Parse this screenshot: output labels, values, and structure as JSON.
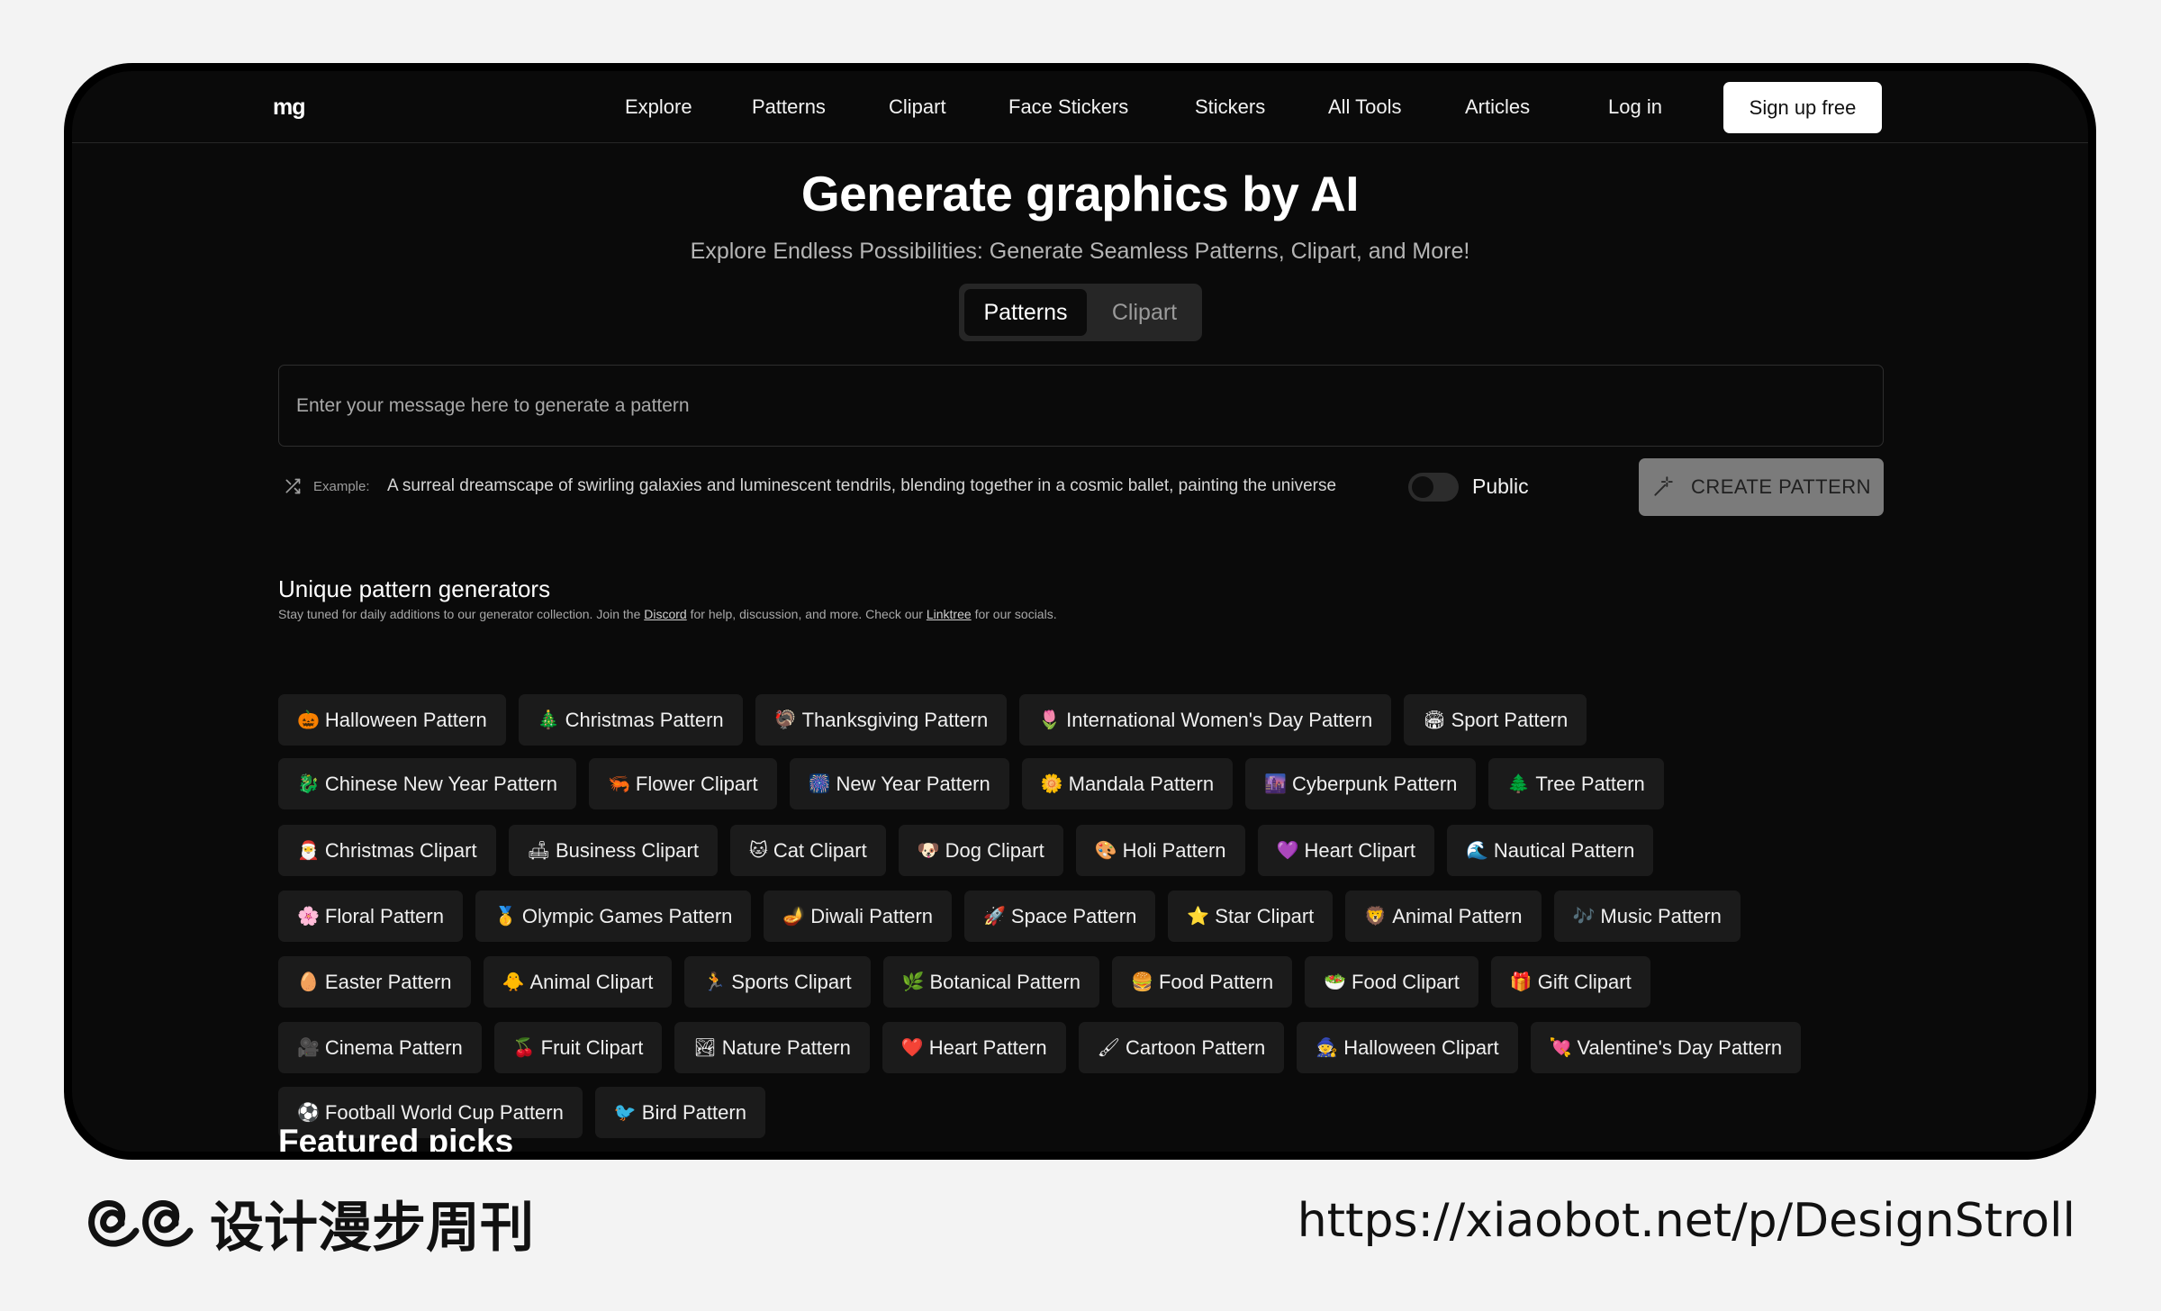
{
  "nav": {
    "logo": "mg",
    "links": [
      "Explore",
      "Patterns",
      "Clipart",
      "Face Stickers",
      "Stickers",
      "All Tools",
      "Articles"
    ],
    "login": "Log in",
    "signup": "Sign up free"
  },
  "hero": {
    "title": "Generate graphics by AI",
    "subtitle": "Explore Endless Possibilities: Generate Seamless Patterns, Clipart, and More!"
  },
  "segmented": {
    "active": "Patterns",
    "inactive": "Clipart"
  },
  "prompt": {
    "placeholder": "Enter your message here to generate a pattern"
  },
  "example": {
    "label": "Example:",
    "text": "A surreal dreamscape of swirling galaxies and luminescent tendrils, blending together in a cosmic ballet, painting the universe"
  },
  "visibility": {
    "label": "Public",
    "on": false
  },
  "create_button": "CREATE PATTERN",
  "generators": {
    "title": "Unique pattern generators",
    "sub_prefix": "Stay tuned for daily additions to our generator collection. Join the",
    "discord": "Discord",
    "sub_middle": "for help, discussion, and more. Check our",
    "linktree": "Linktree",
    "sub_suffix": "for our socials.",
    "rows": [
      [
        {
          "icon": "🎃",
          "label": "Halloween Pattern"
        },
        {
          "icon": "🎄",
          "label": "Christmas Pattern"
        },
        {
          "icon": "🦃",
          "label": "Thanksgiving Pattern"
        },
        {
          "icon": "🌷",
          "label": "International Women's Day Pattern"
        },
        {
          "icon": "🏟",
          "label": "Sport Pattern"
        }
      ],
      [
        {
          "icon": "🐉",
          "label": "Chinese New Year Pattern"
        },
        {
          "icon": "🦐",
          "label": "Flower Clipart"
        },
        {
          "icon": "🎆",
          "label": "New Year Pattern"
        },
        {
          "icon": "🌼",
          "label": "Mandala Pattern"
        },
        {
          "icon": "🌆",
          "label": "Cyberpunk Pattern"
        },
        {
          "icon": "🌲",
          "label": "Tree Pattern"
        }
      ],
      [
        {
          "icon": "🎅",
          "label": "Christmas Clipart"
        },
        {
          "icon": "🛋",
          "label": "Business Clipart"
        },
        {
          "icon": "🐱",
          "label": "Cat Clipart"
        },
        {
          "icon": "🐶",
          "label": "Dog Clipart"
        },
        {
          "icon": "🎨",
          "label": "Holi Pattern"
        },
        {
          "icon": "💜",
          "label": "Heart Clipart"
        },
        {
          "icon": "🌊",
          "label": "Nautical Pattern"
        }
      ],
      [
        {
          "icon": "🌸",
          "label": "Floral Pattern"
        },
        {
          "icon": "🥇",
          "label": "Olympic Games Pattern"
        },
        {
          "icon": "🪔",
          "label": "Diwali Pattern"
        },
        {
          "icon": "🚀",
          "label": "Space Pattern"
        },
        {
          "icon": "⭐",
          "label": "Star Clipart"
        },
        {
          "icon": "🦁",
          "label": "Animal Pattern"
        },
        {
          "icon": "🎶",
          "label": "Music Pattern"
        }
      ],
      [
        {
          "icon": "🥚",
          "label": "Easter Pattern"
        },
        {
          "icon": "🐥",
          "label": "Animal Clipart"
        },
        {
          "icon": "🏃",
          "label": "Sports Clipart"
        },
        {
          "icon": "🌿",
          "label": "Botanical Pattern"
        },
        {
          "icon": "🍔",
          "label": "Food Pattern"
        },
        {
          "icon": "🥗",
          "label": "Food Clipart"
        },
        {
          "icon": "🎁",
          "label": "Gift Clipart"
        }
      ],
      [
        {
          "icon": "🎥",
          "label": "Cinema Pattern"
        },
        {
          "icon": "🍒",
          "label": "Fruit Clipart"
        },
        {
          "icon": "🏞",
          "label": "Nature Pattern"
        },
        {
          "icon": "❤️",
          "label": "Heart Pattern"
        },
        {
          "icon": "🖌",
          "label": "Cartoon Pattern"
        },
        {
          "icon": "🧙",
          "label": "Halloween Clipart"
        },
        {
          "icon": "💘",
          "label": "Valentine's Day Pattern"
        }
      ],
      [
        {
          "icon": "⚽",
          "label": "Football World Cup Pattern"
        },
        {
          "icon": "🐦",
          "label": "Bird Pattern"
        }
      ]
    ]
  },
  "featured_title": "Featured picks",
  "footer": {
    "brand": "设计漫步周刊",
    "url": "https://xiaobot.net/p/DesignStroll"
  }
}
